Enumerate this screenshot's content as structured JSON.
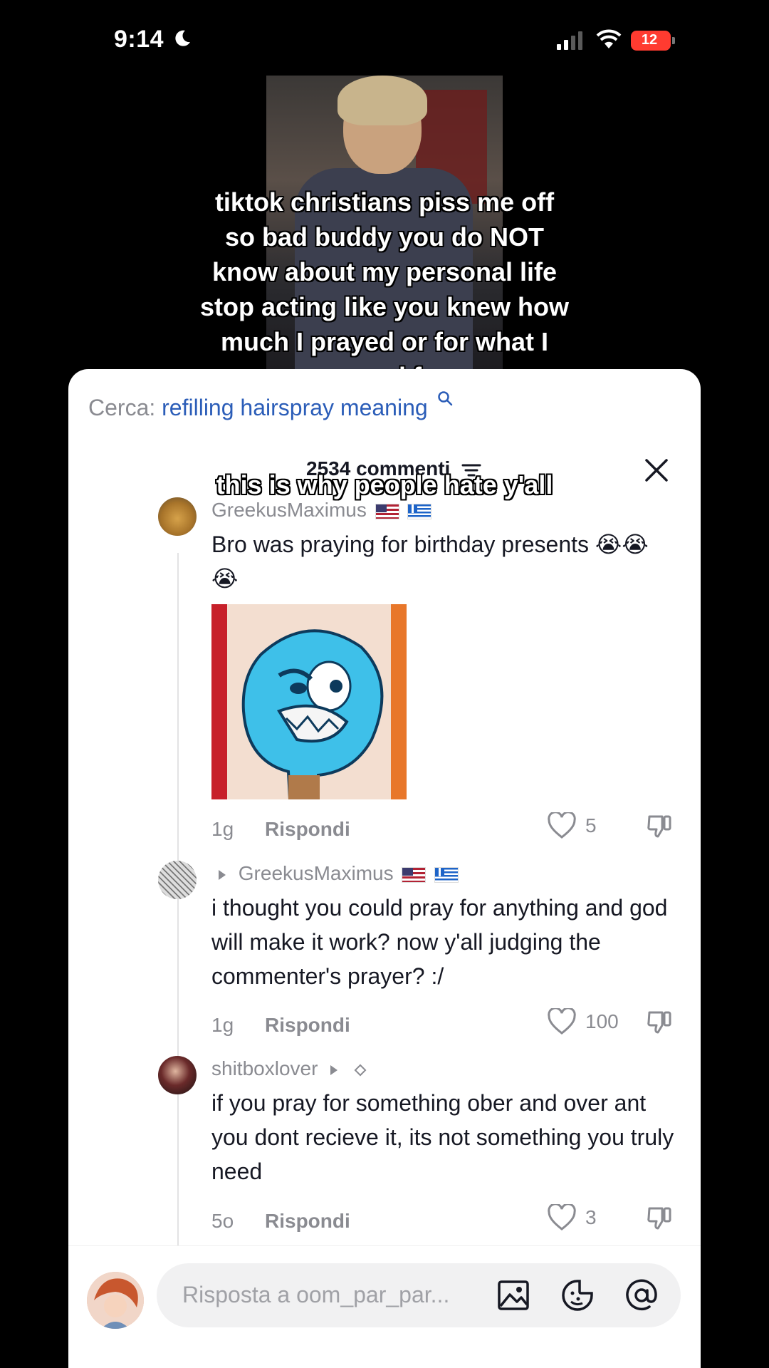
{
  "status_bar": {
    "time": "9:14",
    "battery": "12"
  },
  "video": {
    "caption_main": "tiktok christians piss me off so bad buddy you do NOT know about my personal life stop acting like you knew how much I prayed or for what I prayed for",
    "caption_secondary": "this is why people hate y'all"
  },
  "comments_panel": {
    "search_prefix": "Cerca:",
    "search_term": "refilling hairspray meaning",
    "count_label": "2534 commenti",
    "comments": [
      {
        "author": "GreekusMaximus",
        "text": "Bro was praying for birthday presents 😭😭😭",
        "age": "1g",
        "reply_label": "Rispondi",
        "likes": "5"
      },
      {
        "author": "GreekusMaximus",
        "text": "i thought you could pray for anything and god will make it work? now y'all judging the commenter's prayer? :/",
        "age": "1g",
        "reply_label": "Rispondi",
        "likes": "100"
      },
      {
        "author": "shitboxlover",
        "text": "if you pray for something ober and over ant you dont recieve it, its not something you truly need",
        "age": "5o",
        "reply_label": "Rispondi",
        "likes": "3"
      }
    ]
  },
  "input_bar": {
    "placeholder": "Risposta a oom_par_par..."
  },
  "icons": {
    "search": "search-icon",
    "filter": "filter-icon",
    "close": "close-icon",
    "like": "heart-icon",
    "dislike": "thumbs-down-icon",
    "image": "image-icon",
    "emoji": "sticker-icon",
    "mention": "at-icon"
  },
  "colors": {
    "search_link": "#2b5db8",
    "battery": "#ff3b30",
    "muted_text": "#8a8b91"
  }
}
